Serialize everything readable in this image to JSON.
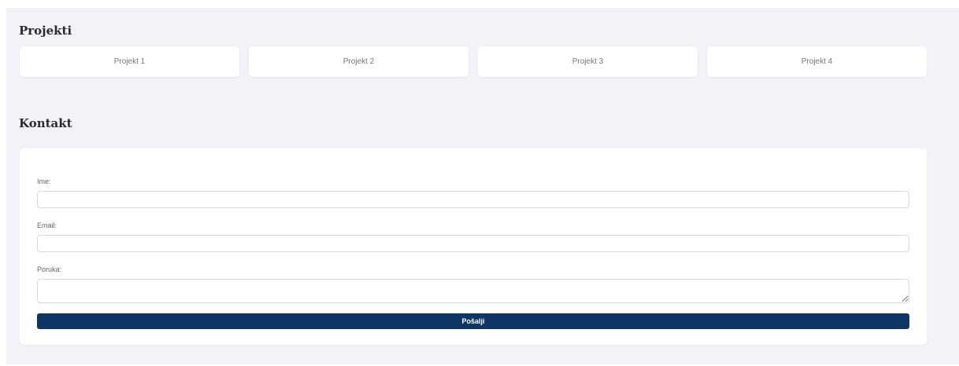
{
  "projects": {
    "title": "Projekti",
    "items": [
      {
        "label": "Projekt 1"
      },
      {
        "label": "Projekt 2"
      },
      {
        "label": "Projekt 3"
      },
      {
        "label": "Projekt 4"
      }
    ]
  },
  "contact": {
    "title": "Kontakt",
    "fields": {
      "name": {
        "label": "Ime:",
        "value": "",
        "placeholder": ""
      },
      "email": {
        "label": "Email:",
        "value": "",
        "placeholder": ""
      },
      "message": {
        "label": "Poruka:",
        "value": "",
        "placeholder": ""
      }
    },
    "submit_label": "Pošalji"
  },
  "colors": {
    "background": "#f3f3f7",
    "card": "#ffffff",
    "accent": "#0d3566"
  }
}
